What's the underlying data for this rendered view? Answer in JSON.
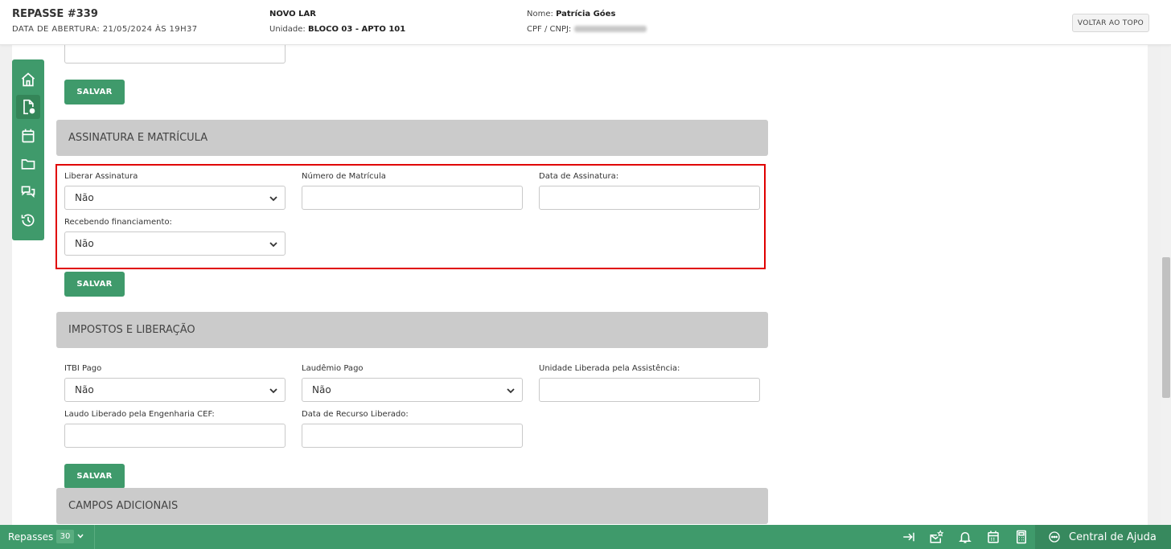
{
  "header": {
    "title": "REPASSE #339",
    "subtitle": "DATA DE ABERTURA: 21/05/2024 ÀS 19H37",
    "project": "NOVO LAR",
    "unit_label": "Unidade:",
    "unit_value": "BLOCO 03 - APTO 101",
    "name_label": "Nome:",
    "name_value": "Patrícia Góes",
    "cpf_label": "CPF / CNPJ:",
    "top_button": "VOLTAR AO TOPO"
  },
  "sidebar": {
    "items": [
      {
        "icon": "home-icon"
      },
      {
        "icon": "document-icon",
        "active": true
      },
      {
        "icon": "calendar-icon"
      },
      {
        "icon": "folder-icon"
      },
      {
        "icon": "chat-icon"
      },
      {
        "icon": "history-icon"
      }
    ]
  },
  "buttons": {
    "save": "SALVAR"
  },
  "assinatura": {
    "title": "ASSINATURA E MATRÍCULA",
    "liberar_label": "Liberar Assinatura",
    "liberar_value": "Não",
    "matricula_label": "Número de Matrícula",
    "matricula_value": "",
    "data_label": "Data de Assinatura:",
    "data_value": "",
    "financiamento_label": "Recebendo financiamento:",
    "financiamento_value": "Não"
  },
  "impostos": {
    "title": "IMPOSTOS E LIBERAÇÃO",
    "itbi_label": "ITBI Pago",
    "itbi_value": "Não",
    "laudemio_label": "Laudêmio Pago",
    "laudemio_value": "Não",
    "unidade_label": "Unidade Liberada pela Assistência:",
    "unidade_value": "",
    "laudo_label": "Laudo Liberado pela Engenharia CEF:",
    "laudo_value": "",
    "recurso_label": "Data de Recurso Liberado:",
    "recurso_value": ""
  },
  "adicionais": {
    "title": "CAMPOS ADICIONAIS"
  },
  "bottombar": {
    "repasses_label": "Repasses",
    "count": "30",
    "icons": [
      "collapse-right-icon",
      "mail-star-icon",
      "bell-icon",
      "calendar-icon",
      "calculator-icon"
    ],
    "help": "Central de Ajuda"
  },
  "colors": {
    "primary": "#3f9a6b",
    "section": "#cbcbcb",
    "highlight": "#e00000"
  }
}
